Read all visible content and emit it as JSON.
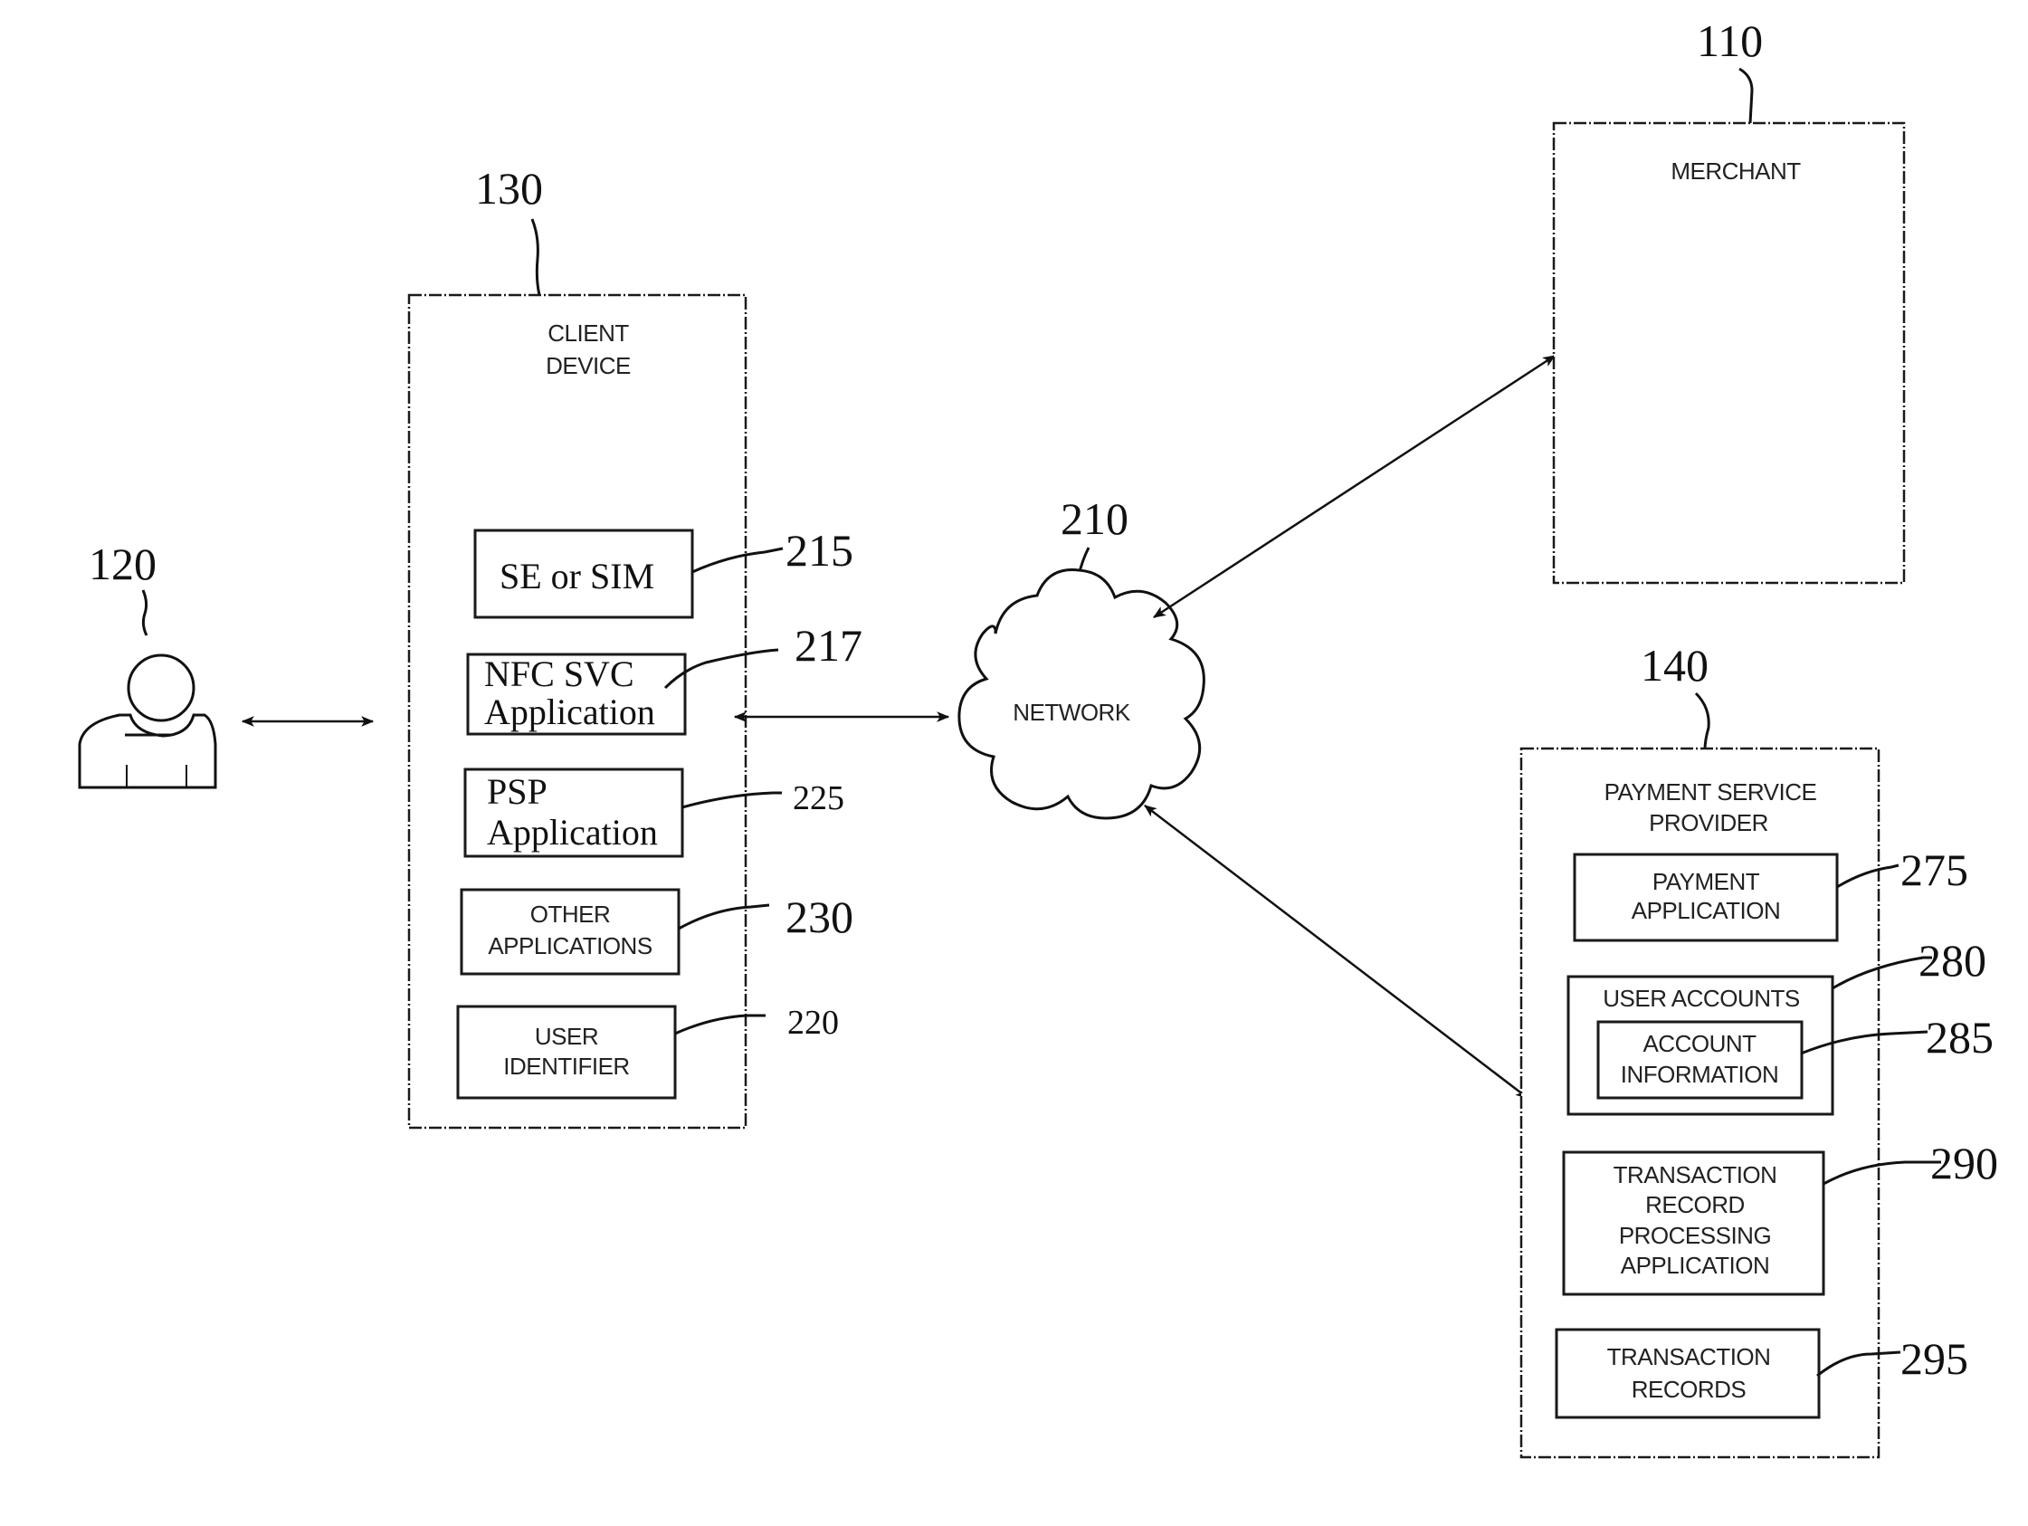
{
  "figure": {
    "user": {
      "ref": "120"
    },
    "client_device": {
      "ref": "130",
      "title_lines": [
        "CLIENT",
        "DEVICE"
      ],
      "components": [
        {
          "ref": "215",
          "lines": [
            "SE or SIM"
          ],
          "style": "serif"
        },
        {
          "ref": "217",
          "lines": [
            "NFC SVC",
            "Application"
          ],
          "style": "serif"
        },
        {
          "ref": "225",
          "lines": [
            "PSP",
            "Application"
          ],
          "style": "serif"
        },
        {
          "ref": "230",
          "lines": [
            "OTHER",
            "APPLICATIONS"
          ],
          "style": "sans"
        },
        {
          "ref": "220",
          "lines": [
            "USER",
            "IDENTIFIER"
          ],
          "style": "sans"
        }
      ]
    },
    "network": {
      "ref": "210",
      "label": "NETWORK"
    },
    "merchant": {
      "ref": "110",
      "label": "MERCHANT"
    },
    "payment_service_provider": {
      "ref": "140",
      "title_lines": [
        "PAYMENT SERVICE",
        "PROVIDER"
      ],
      "components": [
        {
          "ref": "275",
          "lines": [
            "PAYMENT",
            "APPLICATION"
          ]
        },
        {
          "ref": "280",
          "lines": [
            "USER ACCOUNTS"
          ],
          "child": {
            "ref": "285",
            "lines": [
              "ACCOUNT",
              "INFORMATION"
            ]
          }
        },
        {
          "ref": "290",
          "lines": [
            "TRANSACTION",
            "RECORD",
            "PROCESSING",
            "APPLICATION"
          ]
        },
        {
          "ref": "295",
          "lines": [
            "TRANSACTION",
            "RECORDS"
          ]
        }
      ]
    },
    "connections": [
      {
        "from": "user",
        "to": "client_device",
        "type": "bidirectional"
      },
      {
        "from": "client_device",
        "to": "network",
        "type": "bidirectional"
      },
      {
        "from": "network",
        "to": "merchant",
        "type": "bidirectional"
      },
      {
        "from": "network",
        "to": "payment_service_provider",
        "type": "bidirectional"
      }
    ]
  }
}
